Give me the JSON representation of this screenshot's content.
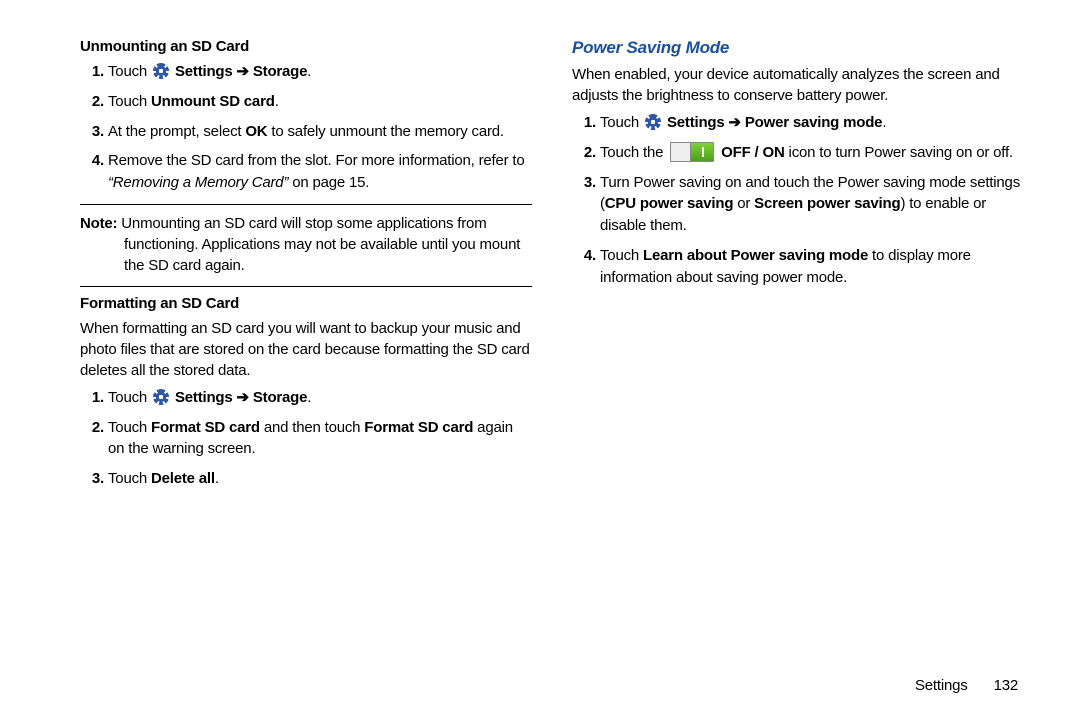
{
  "left": {
    "h1": "Unmounting an SD Card",
    "l1": {
      "i1_pre": "Touch ",
      "i1_post": " Settings ➔ Storage",
      "i1_dot": ".",
      "i2_pre": "Touch ",
      "i2_b": "Unmount SD card",
      "i2_dot": ".",
      "i3_a": "At the prompt, select ",
      "i3_b": "OK",
      "i3_c": " to safely unmount the memory card.",
      "i4_a": "Remove the SD card from the slot. For more information, refer to ",
      "i4_q": "“Removing a Memory Card”",
      "i4_b": " on page 15."
    },
    "note_label": "Note:",
    "note_body": " Unmounting an SD card will stop some applications from functioning. Applications may not be available until you mount the SD card again.",
    "h2": "Formatting an SD Card",
    "p2": "When formatting an SD card you will want to backup your music and photo files that are stored on the card because formatting the SD card deletes all the stored data.",
    "l2": {
      "i1_pre": "Touch ",
      "i1_post": " Settings ➔ Storage",
      "i1_dot": ".",
      "i2_a": "Touch ",
      "i2_b1": "Format SD card",
      "i2_c": " and then touch ",
      "i2_b2": "Format SD card",
      "i2_d": " again on the warning screen.",
      "i3_a": "Touch ",
      "i3_b": "Delete all",
      "i3_dot": "."
    }
  },
  "right": {
    "h1": "Power Saving Mode",
    "p1": "When enabled, your device automatically analyzes the screen and adjusts the brightness to conserve battery power.",
    "l1": {
      "i1_pre": "Touch ",
      "i1_post": " Settings ➔ Power saving mode",
      "i1_dot": ".",
      "i2_a": "Touch the ",
      "i2_b": " OFF / ON",
      "i2_c": " icon to turn Power saving on or off.",
      "i3_a": "Turn Power saving on and touch the Power saving mode settings (",
      "i3_b1": "CPU power saving",
      "i3_m": " or ",
      "i3_b2": "Screen power saving",
      "i3_c": ") to enable or disable them.",
      "i4_a": "Touch ",
      "i4_b": "Learn about Power saving mode",
      "i4_c": " to display more information about saving power mode."
    }
  },
  "footer": {
    "section": "Settings",
    "page": "132"
  }
}
